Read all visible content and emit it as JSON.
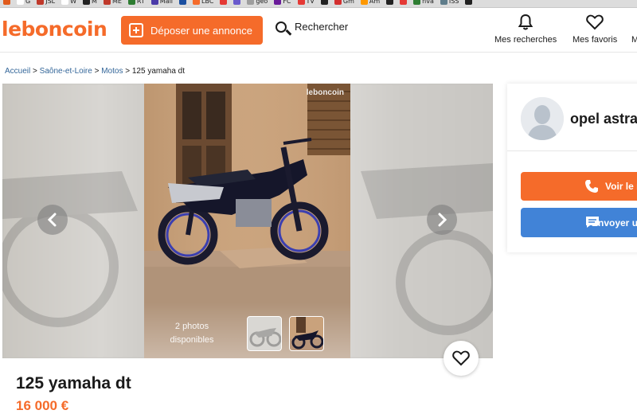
{
  "bookmarks": [
    {
      "label": "",
      "color": "#e05a1b"
    },
    {
      "label": "G",
      "color": "#ffffff"
    },
    {
      "label": "JSL",
      "color": "#c0392b"
    },
    {
      "label": "W",
      "color": "#ffffff"
    },
    {
      "label": "M",
      "color": "#222222"
    },
    {
      "label": "ME",
      "color": "#c0392b"
    },
    {
      "label": "RT",
      "color": "#2e7d32"
    },
    {
      "label": "Mail",
      "color": "#4a3aa8"
    },
    {
      "label": "",
      "color": "#1a4fa0"
    },
    {
      "label": "LBC",
      "color": "#f56b2a"
    },
    {
      "label": "",
      "color": "#e53935"
    },
    {
      "label": "",
      "color": "#6a5acd"
    },
    {
      "label": "geo",
      "color": "#9e9e9e"
    },
    {
      "label": "FC",
      "color": "#6a1b9a"
    },
    {
      "label": "TV",
      "color": "#e53935"
    },
    {
      "label": "",
      "color": "#222222"
    },
    {
      "label": "Gm",
      "color": "#d32f2f"
    },
    {
      "label": "Am",
      "color": "#ff9800"
    },
    {
      "label": "",
      "color": "#222222"
    },
    {
      "label": "",
      "color": "#e53935"
    },
    {
      "label": "nva",
      "color": "#2e7d32"
    },
    {
      "label": "ISS",
      "color": "#607d8b"
    },
    {
      "label": "",
      "color": "#222222"
    }
  ],
  "header": {
    "logo": "leboncoin",
    "deposit_label": "Déposer une annonce",
    "search_label": "Rechercher",
    "my_searches_label": "Mes recherches",
    "my_favorites_label": "Mes favoris",
    "more_label": "M"
  },
  "breadcrumb": {
    "home": "Accueil",
    "region": "Saône-et-Loire",
    "category": "Motos",
    "current": "125 yamaha dt",
    "separator": " > "
  },
  "gallery": {
    "watermark": "leboncoin",
    "photo_count_line1": "2 photos",
    "photo_count_line2": "disponibles"
  },
  "listing": {
    "title": "125 yamaha dt",
    "price": "16 000 €"
  },
  "seller": {
    "name": "opel astra",
    "phone_button": "Voir le n",
    "message_button": "Envoyer u"
  },
  "colors": {
    "brand": "#f56b2a",
    "link": "#336699",
    "message_button": "#4183d7"
  }
}
